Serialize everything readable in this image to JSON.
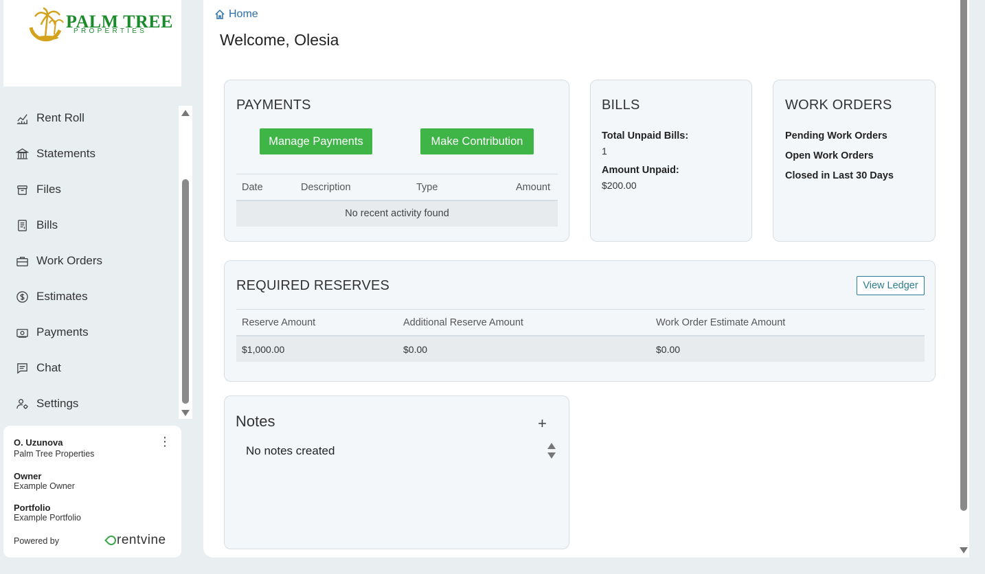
{
  "brand": {
    "name": "PALM TREE",
    "subtitle": "PROPERTIES",
    "primary_color": "#1a8a2b",
    "accent_color": "#d4a21c"
  },
  "sidebar": {
    "items": [
      {
        "label": "Rent Roll",
        "icon": "chart-line-icon"
      },
      {
        "label": "Statements",
        "icon": "bank-icon"
      },
      {
        "label": "Files",
        "icon": "archive-icon"
      },
      {
        "label": "Bills",
        "icon": "receipt-icon"
      },
      {
        "label": "Work Orders",
        "icon": "briefcase-icon"
      },
      {
        "label": "Estimates",
        "icon": "dollar-circle-icon"
      },
      {
        "label": "Payments",
        "icon": "cash-icon"
      },
      {
        "label": "Chat",
        "icon": "chat-icon"
      },
      {
        "label": "Settings",
        "icon": "user-gear-icon"
      }
    ]
  },
  "user": {
    "name": "O. Uzunova",
    "company": "Palm Tree Properties",
    "owner_label": "Owner",
    "owner_value": "Example Owner",
    "portfolio_label": "Portfolio",
    "portfolio_value": "Example Portfolio",
    "powered_by": "Powered by",
    "powered_brand": "rentvine"
  },
  "breadcrumb": {
    "home": "Home"
  },
  "welcome": "Welcome, Olesia",
  "payments": {
    "title": "PAYMENTS",
    "manage_label": "Manage Payments",
    "contribute_label": "Make Contribution",
    "columns": [
      "Date",
      "Description",
      "Type",
      "Amount"
    ],
    "empty": "No recent activity found"
  },
  "bills": {
    "title": "BILLS",
    "total_unpaid_label": "Total Unpaid Bills:",
    "total_unpaid_value": "1",
    "amount_unpaid_label": "Amount Unpaid:",
    "amount_unpaid_value": "$200.00"
  },
  "work_orders": {
    "title": "WORK ORDERS",
    "items": [
      "Pending Work Orders",
      "Open Work Orders",
      "Closed in Last 30 Days"
    ]
  },
  "reserves": {
    "title": "REQUIRED RESERVES",
    "view_ledger": "View Ledger",
    "columns": [
      "Reserve Amount",
      "Additional Reserve Amount",
      "Work Order Estimate Amount"
    ],
    "values": [
      "$1,000.00",
      "$0.00",
      "$0.00"
    ]
  },
  "notes": {
    "title": "Notes",
    "add": "+",
    "empty": "No notes created"
  },
  "colors": {
    "button_green": "#3fb548",
    "link_blue": "#2a6fb0",
    "outline_teal": "#2a7c8f"
  }
}
